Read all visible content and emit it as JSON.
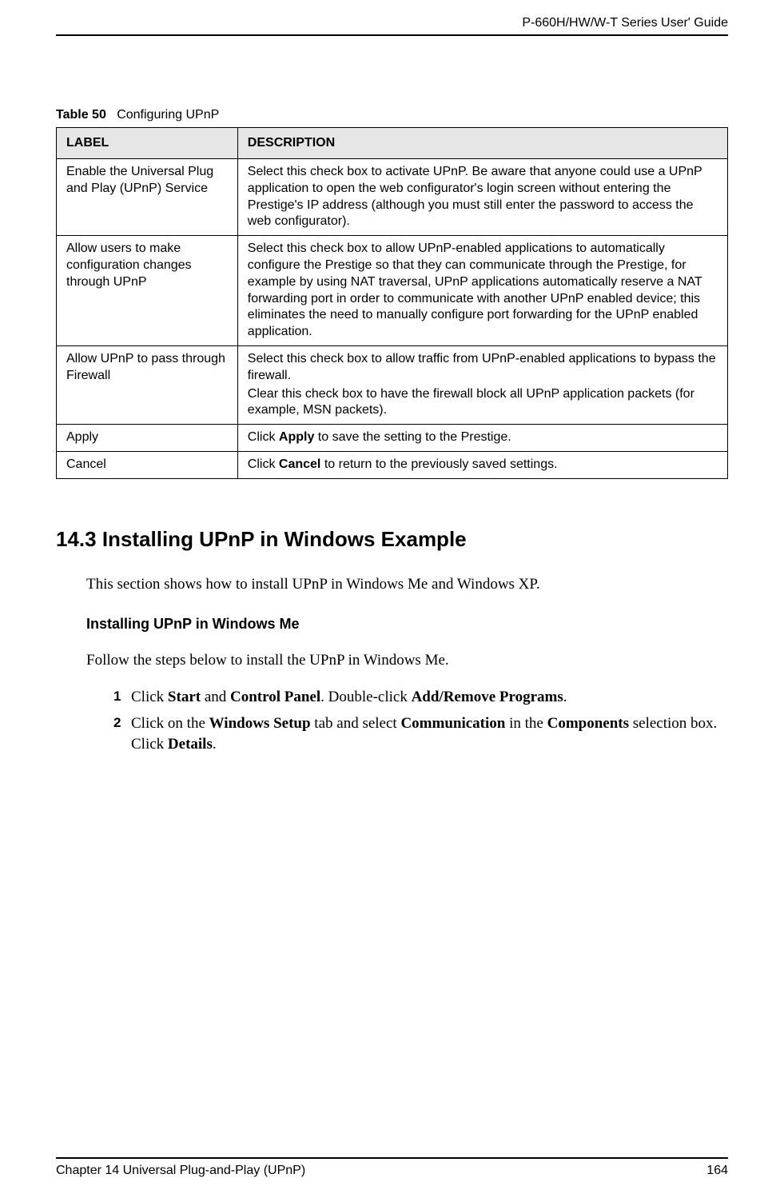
{
  "header": {
    "guide_title": "P-660H/HW/W-T Series User' Guide"
  },
  "table": {
    "caption_prefix": "Table 50",
    "caption_title": "Configuring UPnP",
    "columns": {
      "label": "LABEL",
      "description": "DESCRIPTION"
    },
    "rows": [
      {
        "label": "Enable the Universal Plug and Play (UPnP) Service",
        "description": "Select this check box to activate UPnP. Be aware that anyone could use a UPnP application to open the web configurator's login screen without entering the Prestige's IP address (although you must still enter the password to access the web configurator)."
      },
      {
        "label": "Allow users to make configuration changes through UPnP",
        "description": "Select this check box to allow UPnP-enabled applications to automatically configure the Prestige so that they can communicate through the Prestige, for example by using NAT traversal, UPnP applications automatically reserve a NAT forwarding port in order to communicate with another UPnP enabled device; this eliminates the need to manually configure port forwarding for the UPnP enabled application."
      },
      {
        "label": "Allow UPnP to pass through Firewall",
        "description_p1": "Select this check box to allow traffic from UPnP-enabled applications to bypass the firewall.",
        "description_p2": "Clear this check box to have the firewall block all UPnP application packets (for example, MSN packets)."
      },
      {
        "label": "Apply",
        "description_pre": "Click ",
        "description_bold": "Apply",
        "description_post": " to save the setting to the Prestige."
      },
      {
        "label": "Cancel",
        "description_pre": "Click ",
        "description_bold": "Cancel",
        "description_post": " to return to the previously saved settings."
      }
    ]
  },
  "section": {
    "heading": "14.3  Installing UPnP in Windows Example",
    "intro": "This section shows how to install UPnP in Windows Me and Windows XP.",
    "subheading": "Installing UPnP in Windows Me",
    "subintro": "Follow the steps below to install the UPnP in Windows Me.",
    "steps": [
      {
        "num": "1",
        "parts": [
          {
            "t": "Click "
          },
          {
            "b": "Start"
          },
          {
            "t": " and "
          },
          {
            "b": "Control Panel"
          },
          {
            "t": ". Double-click "
          },
          {
            "b": "Add/Remove Programs"
          },
          {
            "t": "."
          }
        ]
      },
      {
        "num": "2",
        "parts": [
          {
            "t": "Click on the "
          },
          {
            "b": "Windows Setup"
          },
          {
            "t": " tab and select "
          },
          {
            "b": "Communication"
          },
          {
            "t": " in the "
          },
          {
            "b": "Components"
          },
          {
            "t": " selection box. Click "
          },
          {
            "b": "Details"
          },
          {
            "t": "."
          }
        ]
      }
    ]
  },
  "footer": {
    "chapter": "Chapter 14 Universal Plug-and-Play (UPnP)",
    "page": "164"
  }
}
